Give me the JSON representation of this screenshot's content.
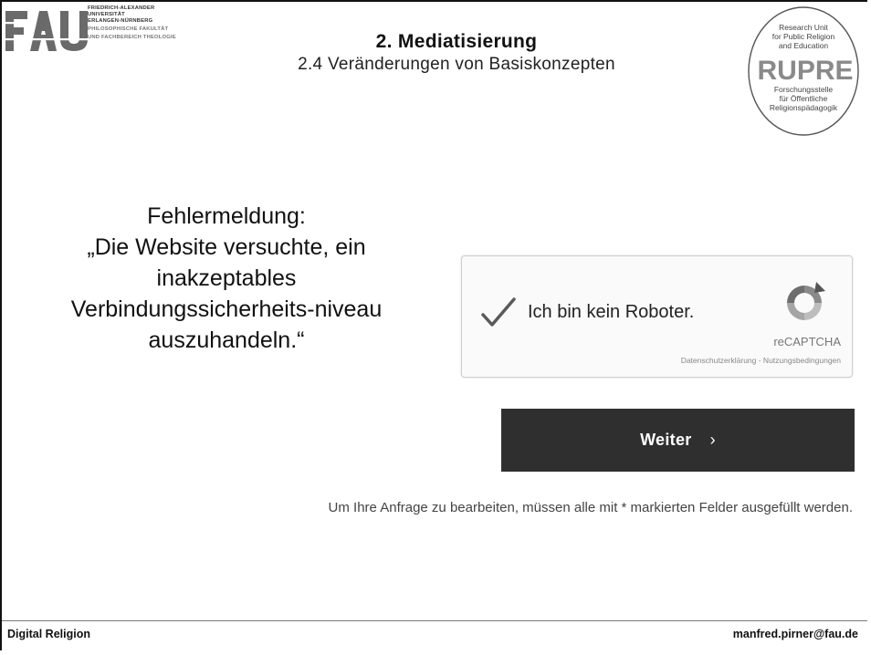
{
  "header": {
    "fau": {
      "letters": "FAU",
      "line1": "FRIEDRICH-ALEXANDER",
      "line2": "UNIVERSITÄT",
      "line3": "ERLANGEN-NÜRNBERG",
      "line4": "PHILOSOPHISCHE FAKULTÄT",
      "line5": "UND FACHBEREICH THEOLOGIE"
    },
    "title": "2. Mediatisierung",
    "subtitle": "2.4 Veränderungen von Basiskonzepten",
    "rupre": {
      "top1": "Research Unit",
      "top2": "for Public Religion",
      "top3": "and Education",
      "big": "RUPRE",
      "bottom1": "Forschungsstelle",
      "bottom2": "für Öffentliche",
      "bottom3": "Religionspädagogik"
    }
  },
  "error": {
    "lines": [
      "Fehlermeldung:",
      "„Die Website versuchte, ein",
      "inakzeptables",
      "Verbindungssicherheits-niveau",
      "auszuhandeln.“"
    ]
  },
  "captcha": {
    "label": "Ich bin kein Roboter.",
    "brand": "reCAPTCHA",
    "links": "Datenschutzerklärung - Nutzungsbedingungen",
    "checked": true
  },
  "form": {
    "submit_label": "Weiter",
    "submit_chevron": "›",
    "required_note": "Um Ihre Anfrage zu bearbeiten, müssen alle mit * markierten Felder ausgefüllt werden."
  },
  "footer": {
    "left": "Digital Religion",
    "right": "manfred.pirner@fau.de"
  },
  "colors": {
    "button_bg": "#2f2f2f",
    "check": "#555555",
    "recaptcha_gray": "#888888"
  }
}
